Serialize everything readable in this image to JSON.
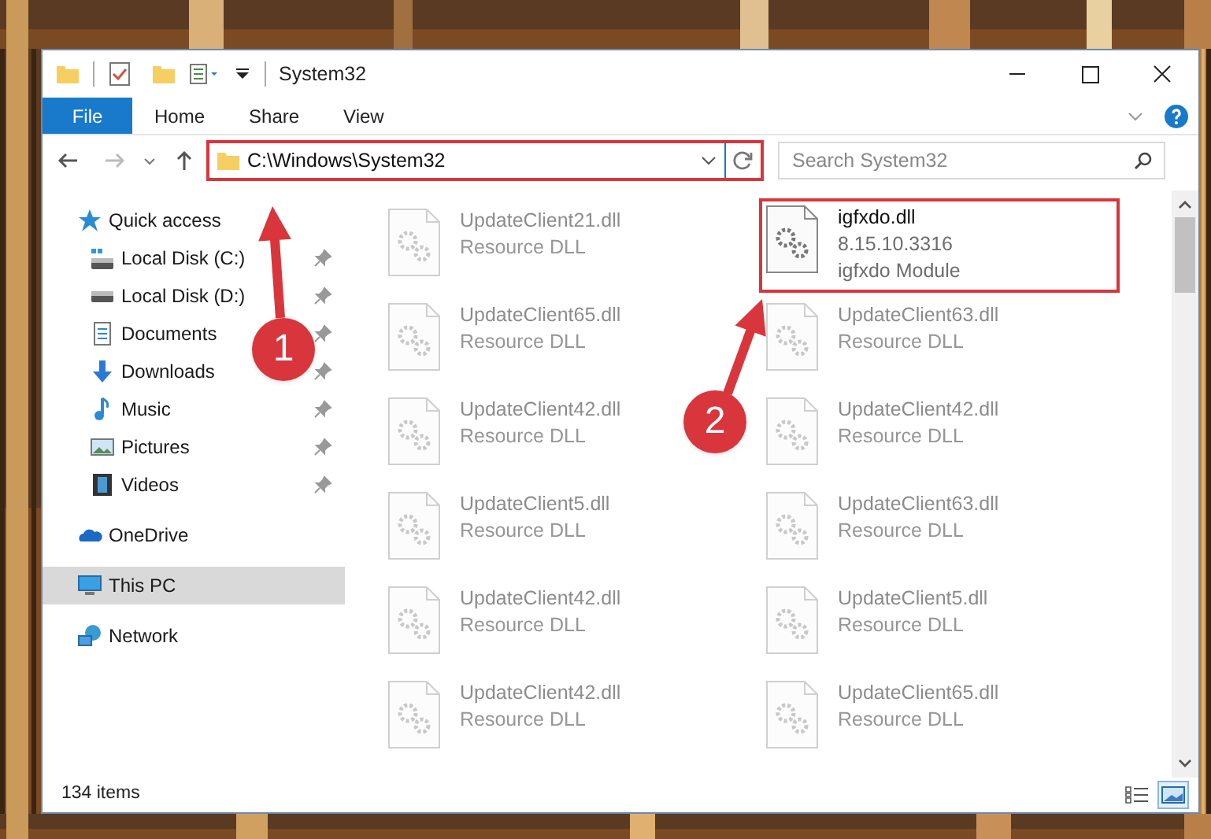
{
  "window": {
    "title": "System32"
  },
  "ribbon_tabs": [
    {
      "label": "File",
      "kind": "file",
      "selected": false
    },
    {
      "label": "Home",
      "kind": "tab",
      "selected": false
    },
    {
      "label": "Share",
      "kind": "tab",
      "selected": false
    },
    {
      "label": "View",
      "kind": "tab",
      "selected": false
    }
  ],
  "address_bar": {
    "path": "C:\\Windows\\System32"
  },
  "search": {
    "placeholder": "Search System32"
  },
  "navigation": [
    {
      "label": "Quick access",
      "kind": "star",
      "selected": false,
      "pinned": false,
      "children": [
        {
          "label": "Local Disk (C:)",
          "kind": "systemdrive",
          "selected": false,
          "pinned": true
        },
        {
          "label": "Local Disk (D:)",
          "kind": "drive",
          "selected": false,
          "pinned": true
        },
        {
          "label": "Documents",
          "kind": "documents",
          "selected": false,
          "pinned": true
        },
        {
          "label": "Downloads",
          "kind": "downloads",
          "selected": false,
          "pinned": true
        },
        {
          "label": "Music",
          "kind": "music",
          "selected": false,
          "pinned": true
        },
        {
          "label": "Pictures",
          "kind": "pictures",
          "selected": false,
          "pinned": true
        },
        {
          "label": "Videos",
          "kind": "videos",
          "selected": false,
          "pinned": true
        }
      ]
    },
    {
      "label": "OneDrive",
      "kind": "cloud",
      "selected": false,
      "pinned": false
    },
    {
      "label": "This PC",
      "kind": "computer",
      "selected": true,
      "pinned": false
    },
    {
      "label": "Network",
      "kind": "network",
      "selected": false,
      "pinned": false
    }
  ],
  "files": [
    {
      "name": "UpdateClient21.dll",
      "details": [
        "Resource DLL"
      ],
      "faded": true
    },
    {
      "name": "igfxdo.dll",
      "details": [
        "8.15.10.3316",
        "igfxdo Module"
      ],
      "faded": false,
      "highlighted": true
    },
    {
      "name": "UpdateClient65.dll",
      "details": [
        "Resource DLL"
      ],
      "faded": true
    },
    {
      "name": "UpdateClient63.dll",
      "details": [
        "Resource DLL"
      ],
      "faded": true
    },
    {
      "name": "UpdateClient42.dll",
      "details": [
        "Resource DLL"
      ],
      "faded": true
    },
    {
      "name": "UpdateClient42.dll",
      "details": [
        "Resource DLL"
      ],
      "faded": true
    },
    {
      "name": "UpdateClient5.dll",
      "details": [
        "Resource DLL"
      ],
      "faded": true
    },
    {
      "name": "UpdateClient63.dll",
      "details": [
        "Resource DLL"
      ],
      "faded": true
    },
    {
      "name": "UpdateClient42.dll",
      "details": [
        "Resource DLL"
      ],
      "faded": true
    },
    {
      "name": "UpdateClient5.dll",
      "details": [
        "Resource DLL"
      ],
      "faded": true
    },
    {
      "name": "UpdateClient42.dll",
      "details": [
        "Resource DLL"
      ],
      "faded": true
    },
    {
      "name": "UpdateClient65.dll",
      "details": [
        "Resource DLL"
      ],
      "faded": true
    }
  ],
  "status_bar": {
    "item_count": "134 items",
    "view_buttons": [
      {
        "kind": "details",
        "selected": false
      },
      {
        "kind": "large",
        "selected": true
      }
    ]
  },
  "annotations": [
    {
      "label": "1"
    },
    {
      "label": "2"
    }
  ]
}
